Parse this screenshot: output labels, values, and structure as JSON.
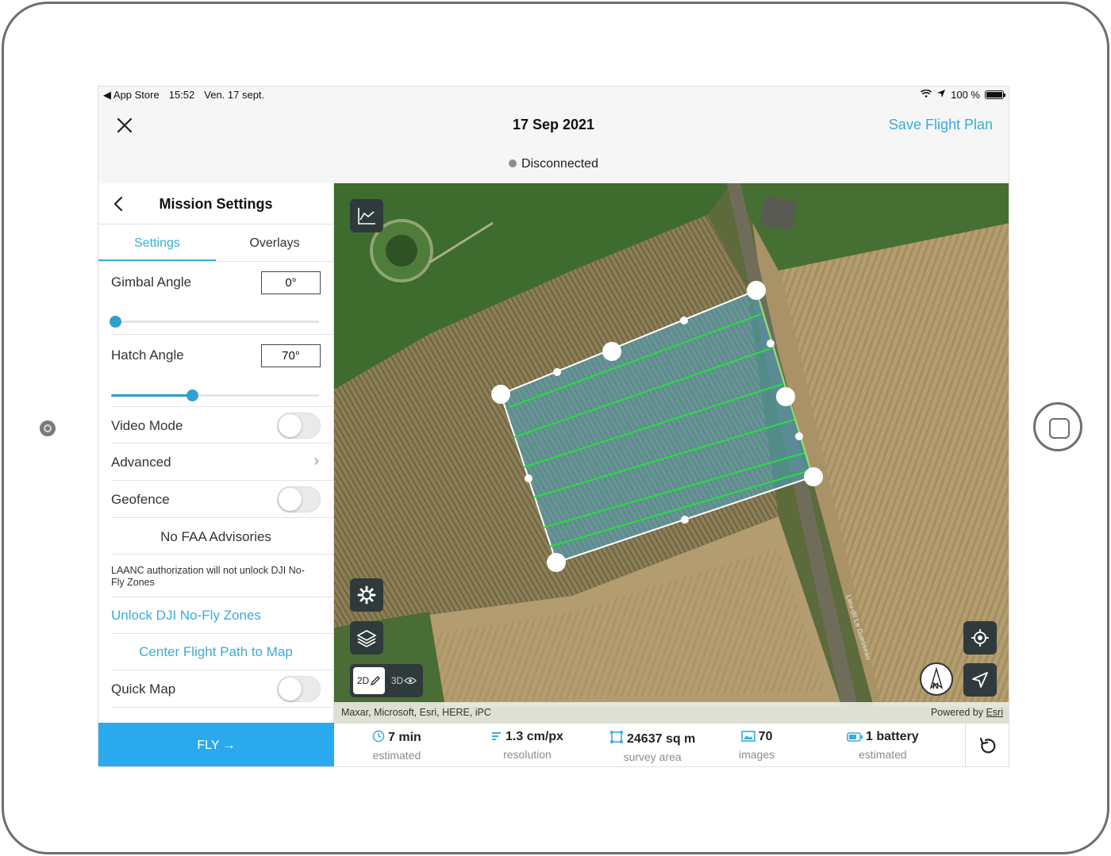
{
  "status_bar": {
    "app_back": "◀ App Store",
    "time": "15:52",
    "date": "Ven. 17 sept.",
    "battery": "100 %"
  },
  "nav": {
    "title": "17 Sep 2021",
    "save_label": "Save Flight Plan",
    "connection": "Disconnected"
  },
  "panel": {
    "title": "Mission Settings",
    "tabs": [
      "Settings",
      "Overlays"
    ],
    "gimbal": {
      "label": "Gimbal Angle",
      "value": "0°",
      "slider": 0.02
    },
    "hatch": {
      "label": "Hatch Angle",
      "value": "70°",
      "slider": 0.39
    },
    "video_mode": {
      "label": "Video Mode",
      "on": false
    },
    "advanced": {
      "label": "Advanced"
    },
    "geofence": {
      "label": "Geofence",
      "on": false
    },
    "faa": "No FAA Advisories",
    "laanc_note": "LAANC authorization will not unlock DJI No-Fly Zones",
    "unlock": "Unlock DJI No-Fly Zones",
    "center": "Center Flight Path to Map",
    "quick_map": {
      "label": "Quick Map",
      "on": false
    },
    "fly": "FLY →"
  },
  "map": {
    "attribution": "Maxar, Microsoft, Esri, HERE, iPC",
    "powered_prefix": "Powered by",
    "powered_link": "Esri",
    "toggle_2d": "2D",
    "toggle_3d": "3D",
    "road_label": "Lieu-dit Le Guesseau"
  },
  "stats": {
    "time": {
      "value": "7 min",
      "sub": "estimated"
    },
    "resolution": {
      "value": "1.3 cm/px",
      "sub": "resolution"
    },
    "area": {
      "value": "24637 sq m",
      "sub": "survey area"
    },
    "images": {
      "value": "70",
      "sub": "images"
    },
    "battery": {
      "value": "1 battery",
      "sub": "estimated"
    }
  },
  "colors": {
    "accent": "#3aabdb",
    "fly_button": "#2aa9ef",
    "flight_line": "#22e03a",
    "polygon_fill": "#4aa6c8"
  }
}
